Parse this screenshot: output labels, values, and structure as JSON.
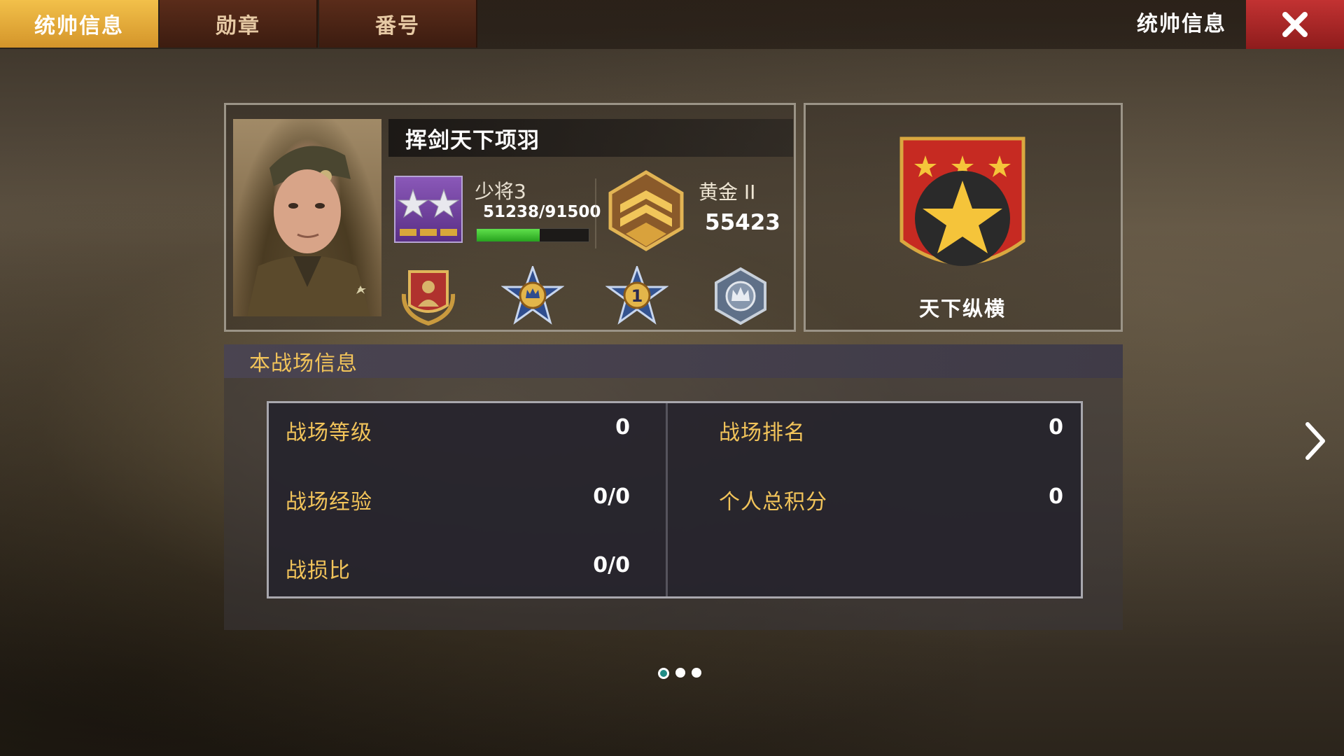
{
  "tabs": [
    {
      "label": "统帅信息",
      "active": true
    },
    {
      "label": "勋章",
      "active": false
    },
    {
      "label": "番号",
      "active": false
    }
  ],
  "header": {
    "title": "统帅信息",
    "close_icon": "close-icon"
  },
  "commander": {
    "name": "挥剑天下项羽",
    "rank_name": "少将3",
    "exp": "51238/91500",
    "exp_progress": 0.56,
    "tier": "黄金 II",
    "score": "55423",
    "medals": [
      "soldier-medal-icon",
      "crown-star-medal-icon",
      "number-one-medal-icon",
      "silver-crown-medal-icon"
    ]
  },
  "legion": {
    "name": "天下纵横",
    "emblem": "legion-shield-icon"
  },
  "battlefield": {
    "title": "本战场信息",
    "left": [
      {
        "label": "战场等级",
        "value": "0"
      },
      {
        "label": "战场经验",
        "value": "0/0"
      },
      {
        "label": "战损比",
        "value": "0/0"
      }
    ],
    "right": [
      {
        "label": "战场排名",
        "value": "0"
      },
      {
        "label": "个人总积分",
        "value": "0"
      }
    ]
  },
  "pagination": {
    "total": 3,
    "active": 1
  },
  "colors": {
    "accent_gold": "#f2c45a",
    "active_tab": "#e8ad3a",
    "close_red": "#b02a2a",
    "exp_green": "#3cc52e"
  }
}
